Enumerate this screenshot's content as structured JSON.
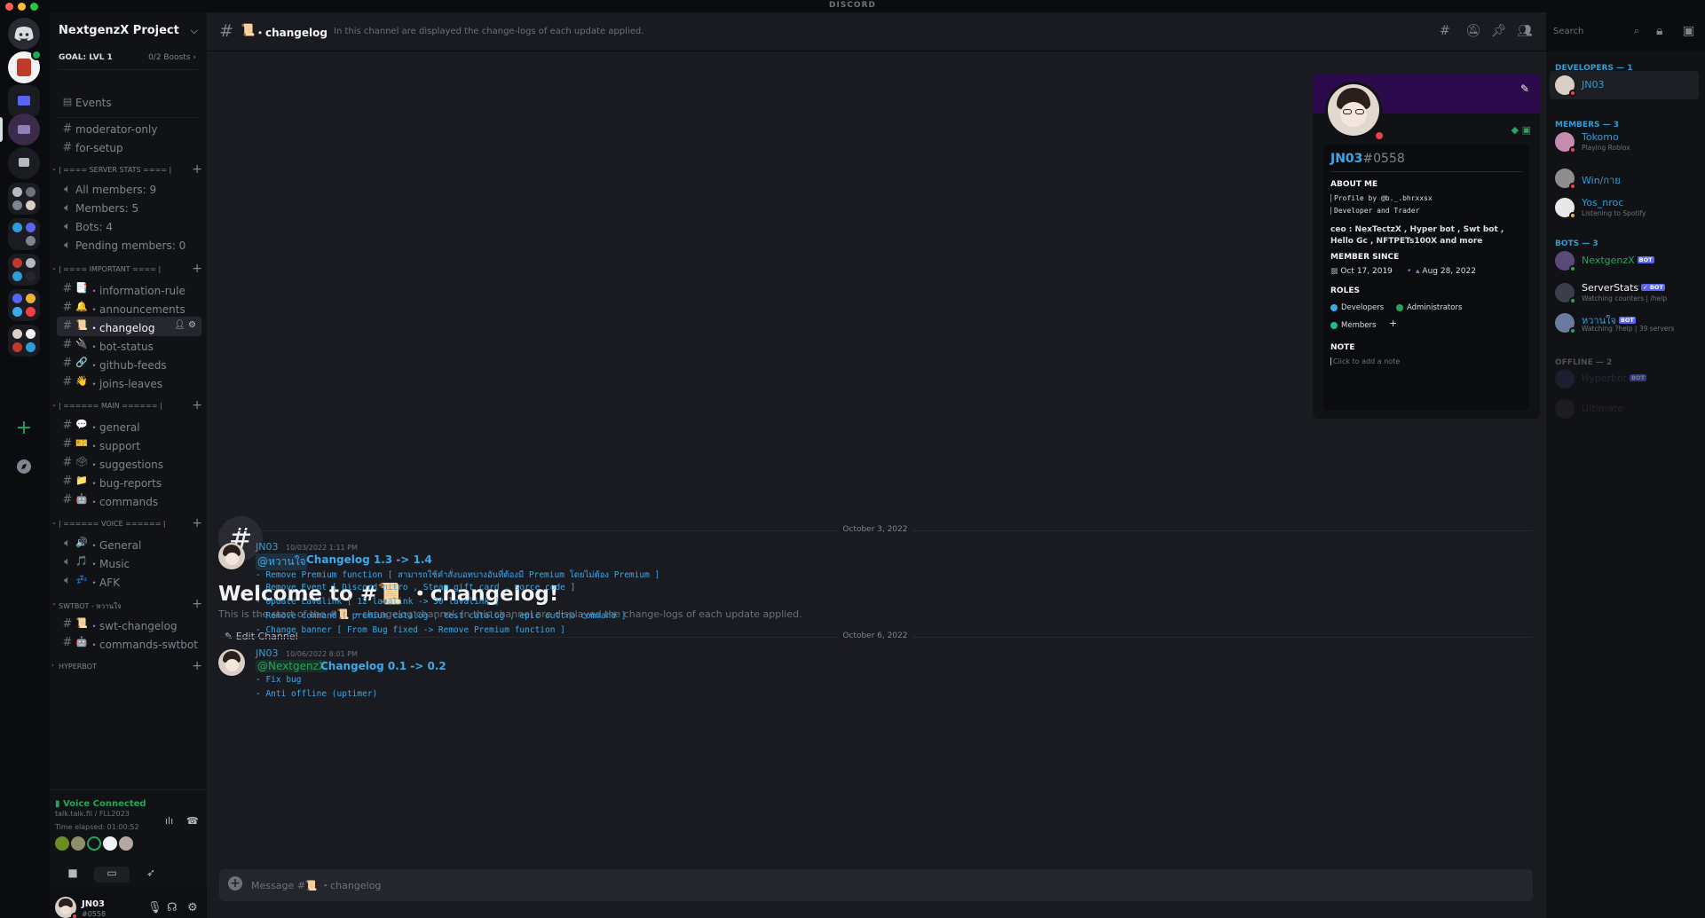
{
  "app": {
    "title": "DISCORD"
  },
  "server": {
    "name": "NextgenzX Project",
    "goal": "GOAL: LVL 1",
    "boosts": "0/2 Boosts",
    "events_label": "Events"
  },
  "channels": {
    "top": [
      {
        "label": "moderator-only"
      },
      {
        "label": "for-setup"
      }
    ],
    "categories": [
      {
        "title": "| ==== SERVER STATS ==== |",
        "items": [
          {
            "label": "All members: 9"
          },
          {
            "label": "Members: 5"
          },
          {
            "label": "Bots: 4"
          },
          {
            "label": "Pending members: 0"
          }
        ]
      },
      {
        "title": "| ==== IMPORTANT ==== |",
        "items": [
          {
            "emoji": "📑",
            "label": "・information-rule"
          },
          {
            "emoji": "🔔",
            "label": "・announcements"
          },
          {
            "emoji": "📜",
            "label": "・changelog"
          },
          {
            "emoji": "🔌",
            "label": "・bot-status"
          },
          {
            "emoji": "🔗",
            "label": "・github-feeds"
          },
          {
            "emoji": "👋",
            "label": "・joins-leaves"
          }
        ]
      },
      {
        "title": "| ====== MAIN ====== |",
        "items": [
          {
            "emoji": "💬",
            "label": "・general"
          },
          {
            "emoji": "🎫",
            "label": "・support"
          },
          {
            "emoji": "🗳",
            "label": "・suggestions"
          },
          {
            "emoji": "📁",
            "label": "・bug-reports"
          },
          {
            "emoji": "🤖",
            "label": "・commands"
          }
        ]
      },
      {
        "title": "| ====== VOICE ====== |",
        "items": [
          {
            "emoji": "🔊",
            "label": "・General"
          },
          {
            "emoji": "🎵",
            "label": "・Music"
          },
          {
            "emoji": "💤",
            "label": "・AFK"
          }
        ]
      },
      {
        "title": "SWTBOT - หวานใจ",
        "items": [
          {
            "emoji": "📜",
            "label": "・swt-changelog"
          },
          {
            "emoji": "🤖",
            "label": "・commands-swtbot"
          }
        ]
      },
      {
        "title": "HYPERBOT",
        "items": []
      }
    ]
  },
  "voice": {
    "status": "Voice Connected",
    "sub": "talk.talk.fil / FLL2023",
    "elapsed": "Time elapsed: 01:00:52"
  },
  "user": {
    "name": "JN03",
    "tag": "#0558"
  },
  "channel": {
    "emoji": "📜",
    "name": "・changelog",
    "topic": "In this channel are displayed the change-logs of each update applied.",
    "search_placeholder": "Search",
    "welcome_title": "Welcome to #📜 ・changelog!",
    "welcome_sub": "This is the start of the #📜 ・changelog channel. In this channel are displayed the change-logs of each update applied.",
    "edit_label": "Edit Channel",
    "input_placeholder": "Message #📜 ・changelog"
  },
  "messages": [
    {
      "date": "October 3, 2022",
      "author": "JN03",
      "time": "10/03/2022 1:11 PM",
      "mention": "@หวานใจ",
      "title": "Changelog 1.3 -> 1.4",
      "lines": [
        "- Remove Premium function [ สามารถใช้คำสั่งบอทบางอันที่ต้องมี Premium โดยไม่ต้อง Premium ]",
        "- Remove Event [ Discord nitro , Steam gift card , sorce code ]",
        "- Update Lavalink [ 12 lavalink -> 30 lavalink ]",
        "- Remove command [ premium catalog , test catalog , epic outtro command ]",
        "- Change banner [ From Bug fixed -> Remove Premium function ]"
      ]
    },
    {
      "date": "October 6, 2022",
      "author": "JN03",
      "time": "10/06/2022 8:01 PM",
      "mention": "@NextgenzX",
      "title": "Changelog 0.1 -> 0.2",
      "lines": [
        "- Fix bug",
        "- Anti offline (uptimer)"
      ]
    }
  ],
  "profile": {
    "name": "JN03",
    "tag": "#0558",
    "about_heading": "ABOUT ME",
    "about_lines": [
      "Profile by @b._.bhrxxsx",
      "Developer and Trader"
    ],
    "about_bold": "ceo : NexTectzX , Hyper bot , Swt bot , Hello Gc , NFTPETs100X and more",
    "member_since_heading": "MEMBER SINCE",
    "discord_since": "Oct 17, 2019",
    "server_since": "Aug 28, 2022",
    "roles_heading": "ROLES",
    "roles": [
      {
        "name": "Developers",
        "color": "#3ea8e6"
      },
      {
        "name": "Administrators",
        "color": "#23a55a"
      },
      {
        "name": "Members",
        "color": "#1abc9c"
      }
    ],
    "note_heading": "NOTE",
    "note_placeholder": "Click to add a note"
  },
  "member_list": {
    "groups": [
      {
        "title": "DEVELOPERS — 1",
        "members": [
          {
            "name": "JN03",
            "sub": "",
            "bot": ""
          }
        ]
      },
      {
        "title": "MEMBERS — 3",
        "members": [
          {
            "name": "Tokomo",
            "sub": "Playing Roblox",
            "bot": ""
          },
          {
            "name": "Win/กาย",
            "sub": "",
            "bot": ""
          },
          {
            "name": "Yos_nroc",
            "sub": "Listening to Spotify",
            "bot": ""
          }
        ]
      },
      {
        "title": "BOTS — 3",
        "members": [
          {
            "name": "NextgenzX",
            "sub": "",
            "bot": "BOT"
          },
          {
            "name": "ServerStats",
            "sub": "Watching counters | /help",
            "bot": "✓ BOT"
          },
          {
            "name": "หวานใจ",
            "sub": "Watching ?help | 39 servers",
            "bot": "BOT"
          }
        ]
      },
      {
        "title": "OFFLINE — 2",
        "members": [
          {
            "name": "Hyperbot",
            "sub": "",
            "bot": "BOT"
          },
          {
            "name": "Ultimate",
            "sub": "",
            "bot": ""
          }
        ]
      }
    ]
  },
  "colors": {
    "accent": "#3ea8e6",
    "online": "#23a55a",
    "dnd": "#f23f43",
    "idle": "#f0b232",
    "banner": "#2a0a4a"
  }
}
